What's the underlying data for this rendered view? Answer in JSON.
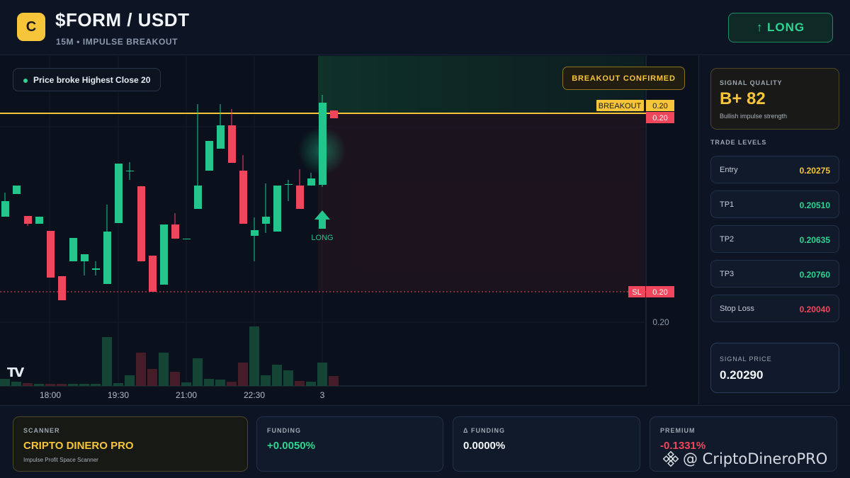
{
  "header": {
    "logo_letter": "C",
    "pair": "$FORM / USDT",
    "subtitle": "15M • IMPULSE BREAKOUT",
    "action_label": "↑ LONG"
  },
  "chart": {
    "legend": "Price broke Highest Close 20",
    "confirm_label": "BREAKOUT CONFIRMED",
    "breakout_tag": "BREAKOUT",
    "breakout_price": "0.20",
    "current_price": "0.20",
    "sl_tag": "SL",
    "sl_price": "0.20",
    "axis_price": "0.20",
    "signal_label": "LONG",
    "tv_logo": "TV",
    "colors": {
      "up": "#22c58b",
      "down": "#f0465c",
      "breakout": "#f6c53a",
      "stop": "#f0465c"
    }
  },
  "chart_data": {
    "type": "candlestick",
    "x_ticks": [
      "18:00",
      "19:30",
      "21:00",
      "22:30",
      "3"
    ],
    "price_ticks": [
      "0.20"
    ],
    "annotations": [
      "BREAKOUT",
      "SL",
      "LONG"
    ],
    "candles": [
      {
        "o": 0.2,
        "h": 0.2,
        "l": 0.2,
        "c": 0.2,
        "dir": "up"
      }
    ],
    "ylim": [
      0.2,
      0.2
    ]
  },
  "sidebar": {
    "quality_label": "SIGNAL QUALITY",
    "quality_value": "B+ 82",
    "quality_desc": "Bullish impulse strength",
    "levels_title": "TRADE LEVELS",
    "levels": [
      {
        "name": "Entry",
        "value": "0.20275",
        "color": "#f6c53a"
      },
      {
        "name": "TP1",
        "value": "0.20510",
        "color": "#2fd493"
      },
      {
        "name": "TP2",
        "value": "0.20635",
        "color": "#2fd493"
      },
      {
        "name": "TP3",
        "value": "0.20760",
        "color": "#2fd493"
      },
      {
        "name": "Stop Loss",
        "value": "0.20040",
        "color": "#f0465c"
      }
    ],
    "signal_price_label": "SIGNAL PRICE",
    "signal_price": "0.20290"
  },
  "bottom": {
    "scanner_label": "SCANNER",
    "scanner_value": "CRIPTO DINERO PRO",
    "scanner_desc": "Impulse Profit Space Scanner",
    "funding_label": "FUNDING",
    "funding_value": "+0.0050%",
    "dfunding_label": "Δ FUNDING",
    "dfunding_value": "0.0000%",
    "premium_label": "PREMIUM",
    "premium_value": "-0.1331%",
    "watermark": "@ CriptoDineroPRO"
  }
}
